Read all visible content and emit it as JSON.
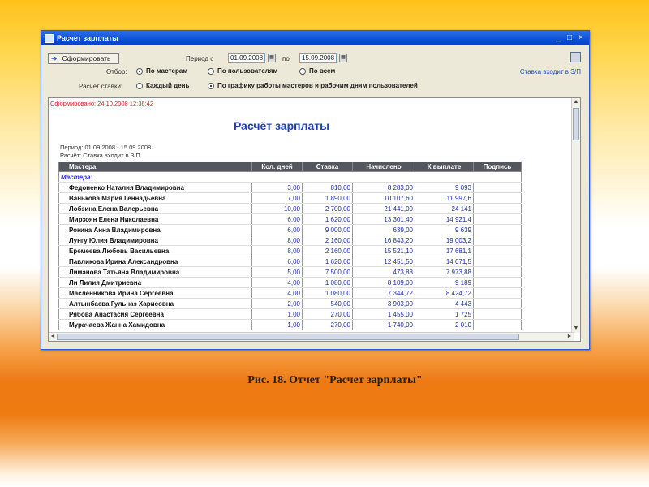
{
  "window": {
    "title": "Расчет зарплаты"
  },
  "toolbar": {
    "form_button": "Сформировать",
    "period_from_label": "Период с",
    "period_from": "01.09.2008",
    "period_to_label": "по",
    "period_to": "15.09.2008",
    "filter_label": "Отбор:",
    "filter_options": [
      {
        "label": "По мастерам",
        "selected": true
      },
      {
        "label": "По пользователям",
        "selected": false
      },
      {
        "label": "По всем",
        "selected": false
      }
    ],
    "rate_label": "Расчет ставки:",
    "rate_options": [
      {
        "label": "Каждый день",
        "selected": false
      },
      {
        "label": "По графику работы мастеров и рабочим дням пользователей",
        "selected": true
      }
    ],
    "rate_link": "Ставка входит в З/П"
  },
  "report": {
    "formed": "Сформировано: 24.10.2008 12:36:42",
    "title": "Расчёт зарплаты",
    "period": "Период: 01.09.2008 - 15.09.2008",
    "calc": "Расчёт: Ставка входит в З/П",
    "columns": [
      "Мастера",
      "Кол. дней",
      "Ставка",
      "Начислено",
      "К выплате",
      "Подпись"
    ],
    "group": "Мастера:",
    "rows": [
      {
        "name": "Федоненко Наталия Владимировна",
        "days": "3,00",
        "rate": "810,00",
        "accrued": "8 283,00",
        "payout": "9 093"
      },
      {
        "name": "Ванькова Мария Геннадьевна",
        "days": "7,00",
        "rate": "1 890,00",
        "accrued": "10 107,60",
        "payout": "11 997,6"
      },
      {
        "name": "Лобзина Елена Валерьевна",
        "days": "10,00",
        "rate": "2 700,00",
        "accrued": "21 441,00",
        "payout": "24 141"
      },
      {
        "name": "Мирзоян Елена Николаевна",
        "days": "6,00",
        "rate": "1 620,00",
        "accrued": "13 301,40",
        "payout": "14 921,4"
      },
      {
        "name": "Рокина Анна Владимировна",
        "days": "6,00",
        "rate": "9 000,00",
        "accrued": "639,00",
        "payout": "9 639"
      },
      {
        "name": "Лунгу Юлия Владимировна",
        "days": "8,00",
        "rate": "2 160,00",
        "accrued": "16 843,20",
        "payout": "19 003,2"
      },
      {
        "name": "Еремеева Любовь Васильевна",
        "days": "8,00",
        "rate": "2 160,00",
        "accrued": "15 521,10",
        "payout": "17 681,1"
      },
      {
        "name": "Павликова Ирина Александровна",
        "days": "6,00",
        "rate": "1 620,00",
        "accrued": "12 451,50",
        "payout": "14 071,5"
      },
      {
        "name": "Лиманова  Татьяна  Владимировна",
        "days": "5,00",
        "rate": "7 500,00",
        "accrued": "473,88",
        "payout": "7 973,88"
      },
      {
        "name": "Ли Лилия Дмитриевна",
        "days": "4,00",
        "rate": "1 080,00",
        "accrued": "8 109,00",
        "payout": "9 189"
      },
      {
        "name": "Масленникова Ирина Сергеевна",
        "days": "4,00",
        "rate": "1 080,00",
        "accrued": "7 344,72",
        "payout": "8 424,72"
      },
      {
        "name": "Алтынбаева Гульназ Харисовна",
        "days": "2,00",
        "rate": "540,00",
        "accrued": "3 903,00",
        "payout": "4 443"
      },
      {
        "name": "Рябова Анастасия Сергеевна",
        "days": "1,00",
        "rate": "270,00",
        "accrued": "1 455,00",
        "payout": "1 725"
      },
      {
        "name": "Мурачаева Жанна Хамидовна",
        "days": "1,00",
        "rate": "270,00",
        "accrued": "1 740,00",
        "payout": "2 010"
      }
    ]
  },
  "caption": "Рис. 18. Отчет \"Расчет зарплаты\""
}
